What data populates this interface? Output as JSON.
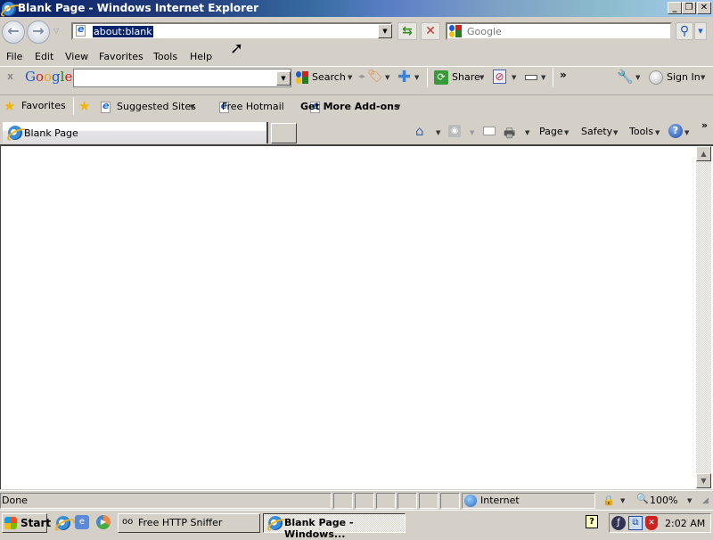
{
  "window": {
    "title": "Blank Page - Windows Internet Explorer",
    "minimize_label": "_",
    "restore_label": "❐",
    "close_label": "✕"
  },
  "address_bar": {
    "url": "about:blank",
    "refresh_icon": "refresh-icon",
    "stop_icon": "stop-icon"
  },
  "search_box": {
    "placeholder": "Google",
    "search_icon": "magnifier-icon"
  },
  "menu": {
    "items": [
      {
        "label": "File",
        "accel": "F"
      },
      {
        "label": "Edit",
        "accel": "E"
      },
      {
        "label": "View",
        "accel": "V"
      },
      {
        "label": "Favorites",
        "accel": "a"
      },
      {
        "label": "Tools",
        "accel": "T"
      },
      {
        "label": "Help",
        "accel": "H"
      }
    ]
  },
  "google_toolbar": {
    "close_label": "x",
    "brand": "Google",
    "search_value": "",
    "search_label": "Search",
    "share_label": "Share",
    "more_label": "»",
    "sign_in_label": "Sign In"
  },
  "favorites_bar": {
    "favorites_label": "Favorites",
    "items": [
      {
        "label": "Suggested Sites",
        "has_dropdown": true
      },
      {
        "label": "Free Hotmail",
        "has_dropdown": false
      },
      {
        "label": "Get More Add-ons",
        "has_dropdown": true
      }
    ]
  },
  "tabs": [
    {
      "label": "Blank Page",
      "active": true
    }
  ],
  "command_bar": {
    "page_label": "Page",
    "safety_label": "Safety",
    "tools_label": "Tools",
    "more_label": "»"
  },
  "status_bar": {
    "status": "Done",
    "zone": "Internet",
    "zoom": "100%"
  },
  "taskbar": {
    "start_label": "Start",
    "buttons": [
      {
        "label": "Free HTTP Sniffer",
        "active": false
      },
      {
        "label": "Blank Page - Windows...",
        "active": true
      }
    ],
    "clock": "2:02 AM",
    "help_icon_label": "?"
  }
}
